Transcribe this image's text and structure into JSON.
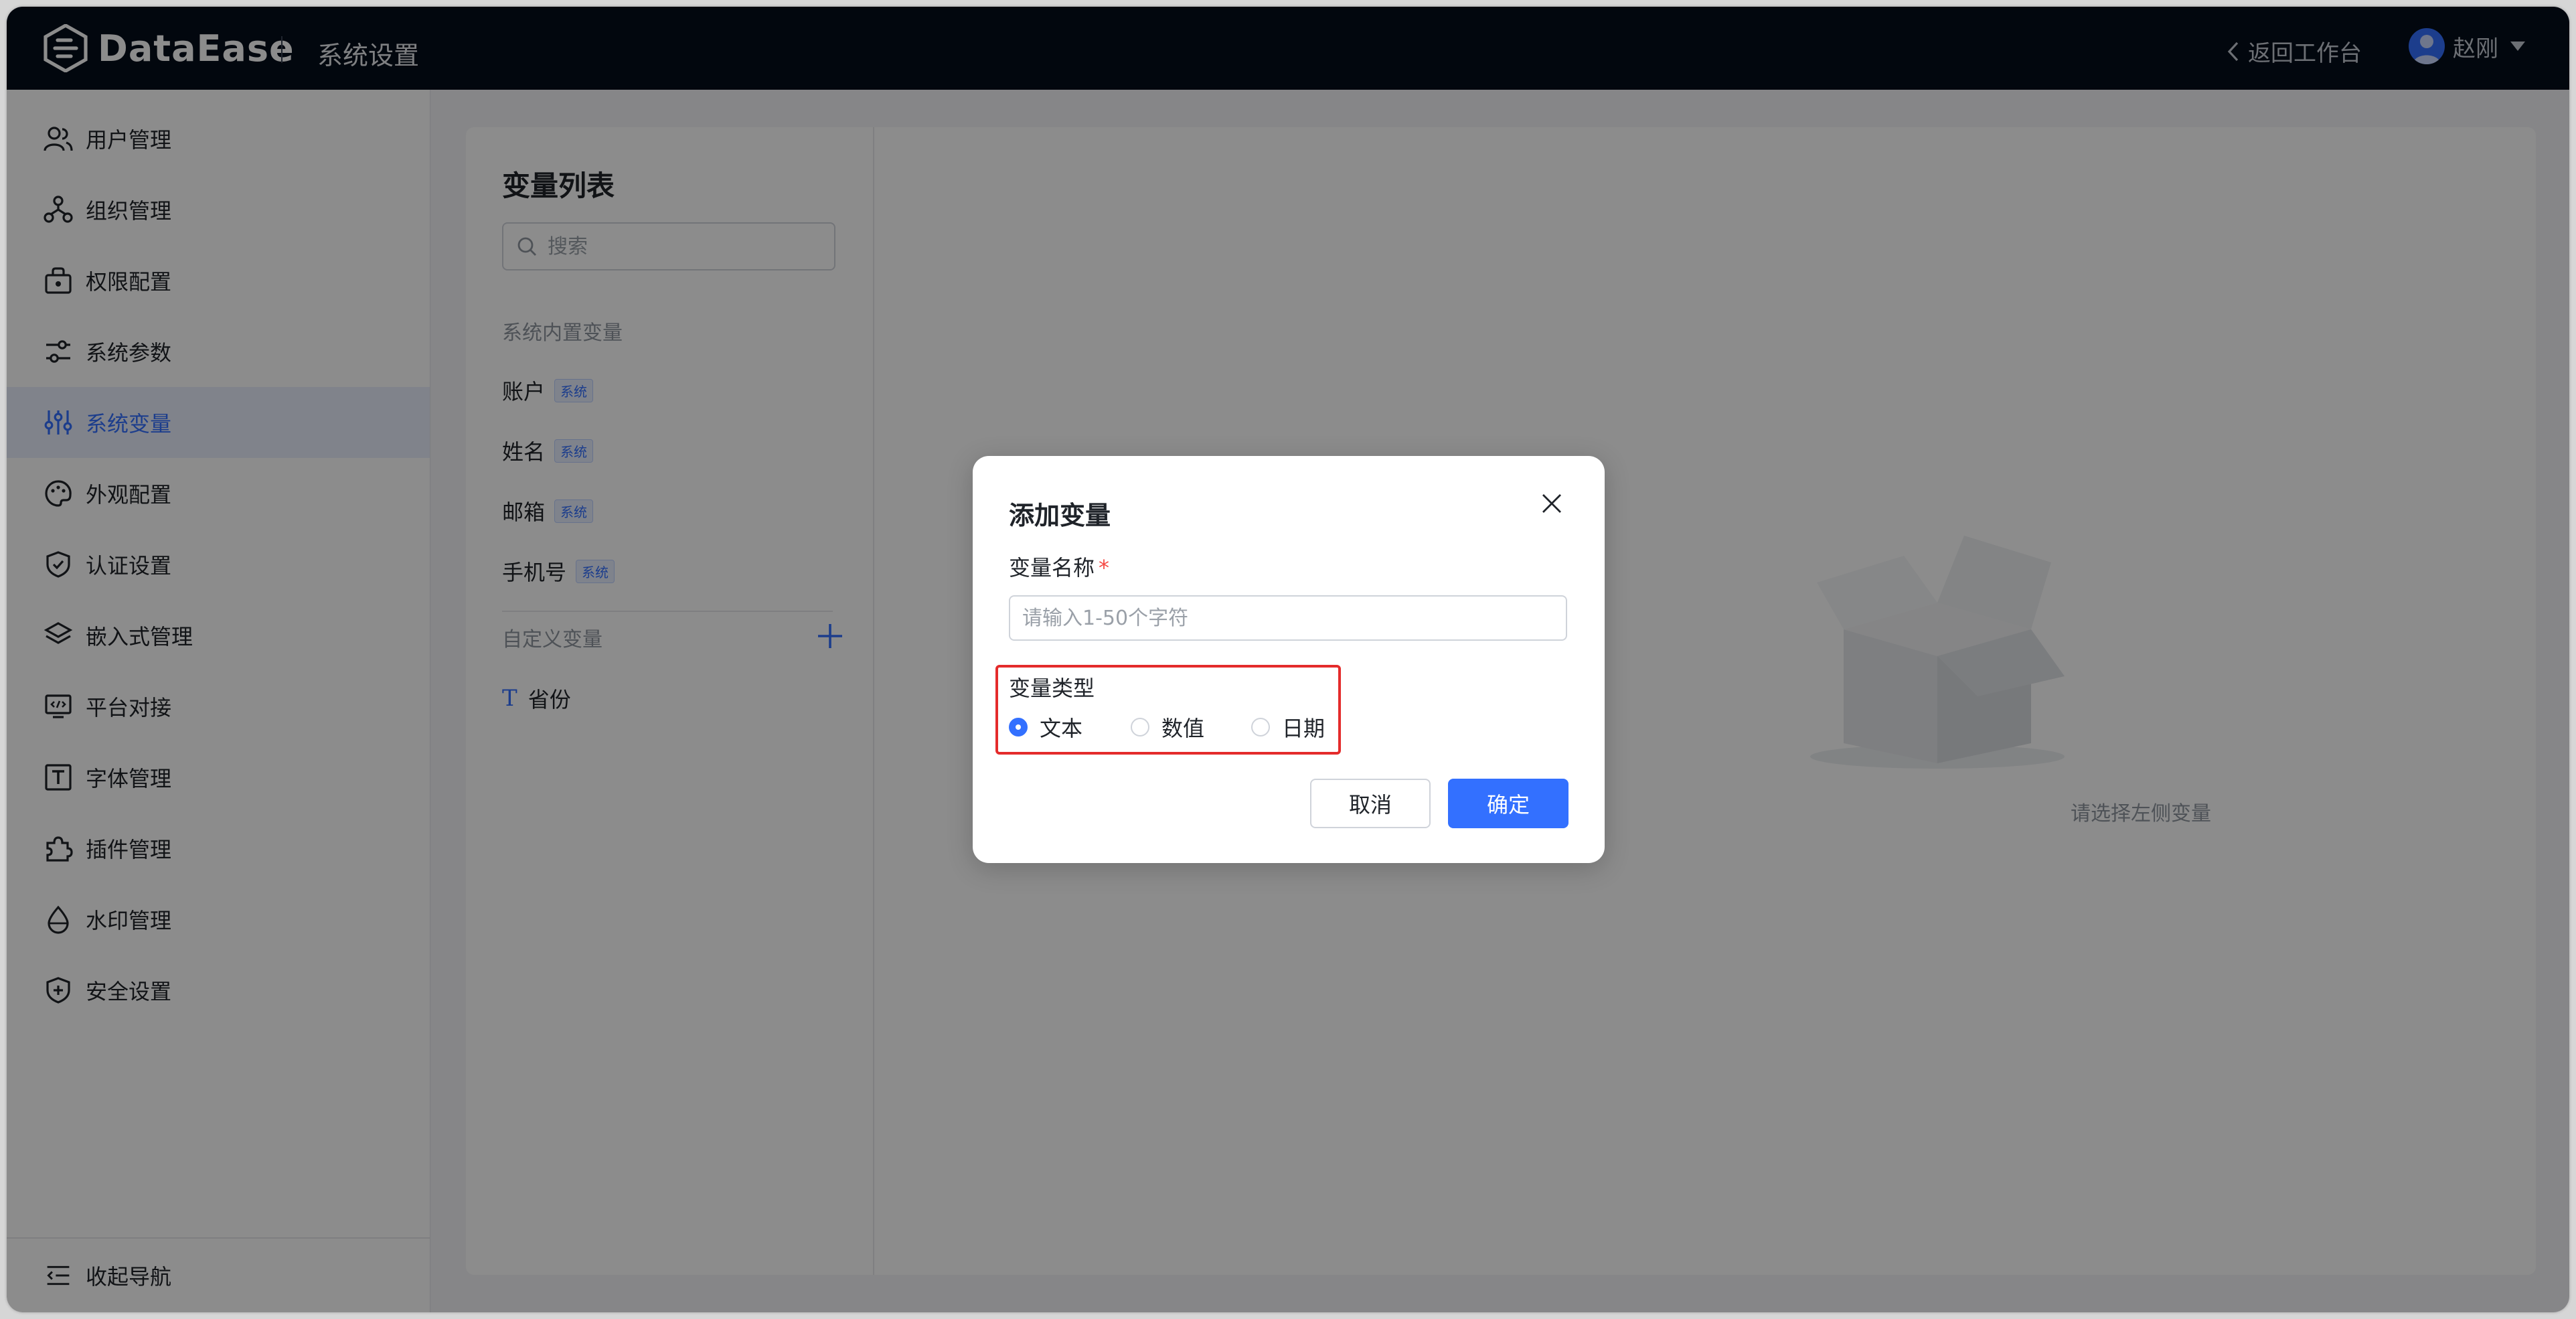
{
  "header": {
    "brand": "DataEase",
    "page_title": "系统设置",
    "back_label": "返回工作台",
    "user_name": "赵刚"
  },
  "sidebar": {
    "items": [
      {
        "label": "用户管理",
        "icon": "users-icon"
      },
      {
        "label": "组织管理",
        "icon": "org-icon"
      },
      {
        "label": "权限配置",
        "icon": "lock-icon"
      },
      {
        "label": "系统参数",
        "icon": "sliders-icon"
      },
      {
        "label": "系统变量",
        "icon": "variable-icon",
        "active": true
      },
      {
        "label": "外观配置",
        "icon": "palette-icon"
      },
      {
        "label": "认证设置",
        "icon": "shield-check-icon"
      },
      {
        "label": "嵌入式管理",
        "icon": "layers-icon"
      },
      {
        "label": "平台对接",
        "icon": "code-monitor-icon"
      },
      {
        "label": "字体管理",
        "icon": "font-icon"
      },
      {
        "label": "插件管理",
        "icon": "puzzle-icon"
      },
      {
        "label": "水印管理",
        "icon": "droplet-icon"
      },
      {
        "label": "安全设置",
        "icon": "shield-plus-icon"
      }
    ],
    "collapse_label": "收起导航"
  },
  "variables": {
    "title": "变量列表",
    "search_placeholder": "搜索",
    "builtin_section": "系统内置变量",
    "builtin_items": [
      {
        "label": "账户",
        "badge": "系统"
      },
      {
        "label": "姓名",
        "badge": "系统"
      },
      {
        "label": "邮箱",
        "badge": "系统"
      },
      {
        "label": "手机号",
        "badge": "系统"
      }
    ],
    "custom_section": "自定义变量",
    "custom_items": [
      {
        "label": "省份",
        "type_icon": "T"
      }
    ]
  },
  "empty_state": {
    "text": "请选择左侧变量"
  },
  "dialog": {
    "title": "添加变量",
    "name_label": "变量名称",
    "name_required_mark": "*",
    "name_placeholder": "请输入1-50个字符",
    "name_value": "",
    "type_label": "变量类型",
    "type_options": [
      "文本",
      "数值",
      "日期"
    ],
    "type_selected": "文本",
    "cancel_label": "取消",
    "confirm_label": "确定"
  },
  "colors": {
    "primary": "#3370ff",
    "header_bg": "#050d1b",
    "highlight": "#e42b2b",
    "required": "#f54a45"
  }
}
